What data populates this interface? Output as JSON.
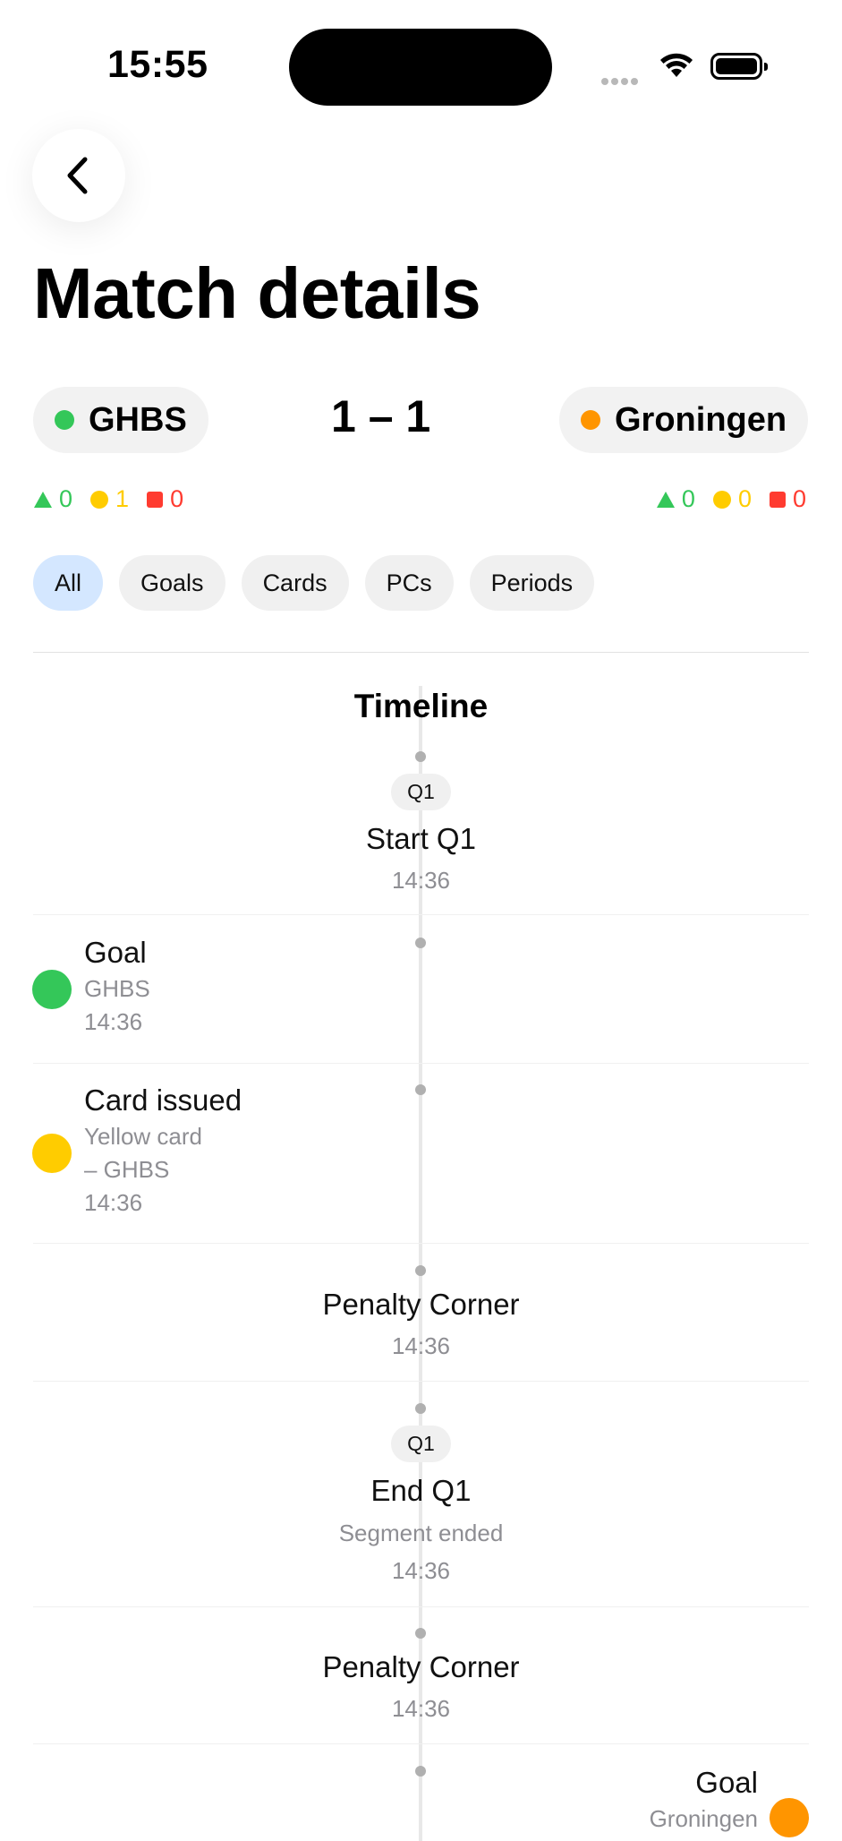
{
  "status_bar": {
    "time": "15:55",
    "icons": [
      "cellular-signal-icon",
      "wifi-icon",
      "battery-icon"
    ]
  },
  "header": {
    "back_icon": "chevron-left-icon",
    "title": "Match details"
  },
  "score": {
    "home": {
      "name": "GHBS",
      "color": "#34c759"
    },
    "away": {
      "name": "Groningen",
      "color": "#ff9500"
    },
    "display": "1 – 1"
  },
  "stats": {
    "home": {
      "pcs": "0",
      "yellow": "1",
      "red": "0"
    },
    "away": {
      "pcs": "0",
      "yellow": "0",
      "red": "0"
    }
  },
  "filters": {
    "active": "All",
    "chips": [
      "All",
      "Goals",
      "Cards",
      "PCs",
      "Periods"
    ]
  },
  "timeline": {
    "title": "Timeline",
    "events": [
      {
        "kind": "period",
        "segment": "Q1",
        "title": "Start Q1",
        "time": "14:36"
      },
      {
        "kind": "goal",
        "side": "home",
        "title": "Goal",
        "team": "GHBS",
        "time": "14:36",
        "color": "#34c759"
      },
      {
        "kind": "card",
        "side": "home",
        "title": "Card issued",
        "detail_1": "Yellow card",
        "detail_2": "– GHBS",
        "time": "14:36",
        "color": "#ffcc00"
      },
      {
        "kind": "pc",
        "title": "Penalty Corner",
        "time": "14:36"
      },
      {
        "kind": "period",
        "segment": "Q1",
        "title": "End Q1",
        "detail": "Segment ended",
        "time": "14:36"
      },
      {
        "kind": "pc",
        "title": "Penalty Corner",
        "time": "14:36"
      },
      {
        "kind": "goal",
        "side": "away",
        "title": "Goal",
        "team": "Groningen",
        "color": "#ff9500"
      }
    ]
  }
}
